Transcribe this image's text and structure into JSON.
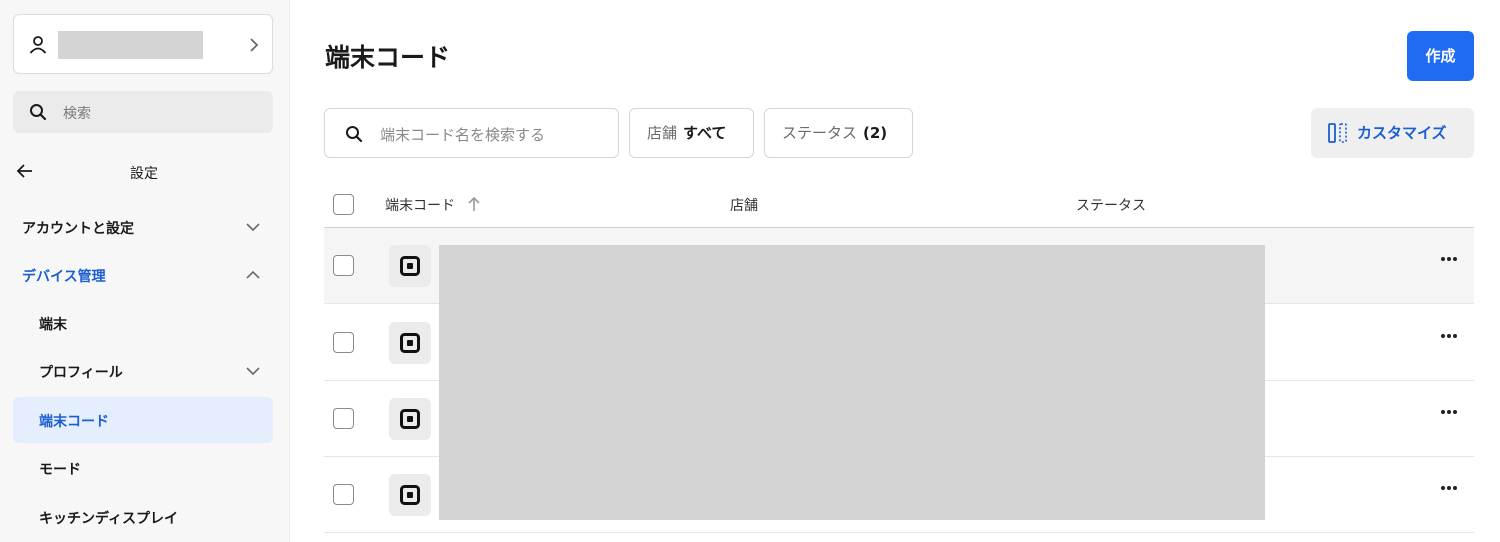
{
  "sidebar": {
    "search_placeholder": "検索",
    "settings_title": "設定",
    "nav": [
      {
        "label": "アカウントと設定",
        "chevron": "down"
      },
      {
        "label": "デバイス管理",
        "chevron": "up"
      },
      {
        "label": "端末"
      },
      {
        "label": "プロフィール",
        "chevron": "down"
      },
      {
        "label": "端末コード",
        "active": true
      },
      {
        "label": "モード"
      },
      {
        "label": "キッチンディスプレイ"
      }
    ]
  },
  "main": {
    "title": "端末コード",
    "create_label": "作成",
    "search_placeholder": "端末コード名を検索する",
    "store_filter": {
      "key": "店舗",
      "value": "すべて"
    },
    "status_filter": {
      "key": "ステータス",
      "value": "(2)"
    },
    "customize_label": "カスタマイズ",
    "columns": [
      "端末コード",
      "店舗",
      "ステータス"
    ]
  },
  "colors": {
    "accent": "#1f6cf2",
    "link": "#1a5fd1",
    "active_bg": "#e5eefc"
  }
}
